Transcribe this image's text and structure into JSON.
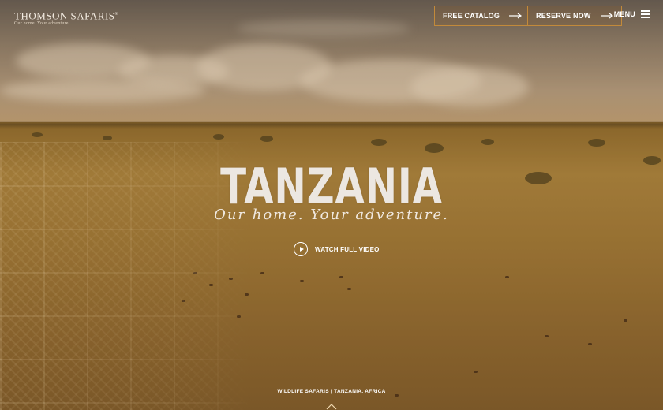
{
  "brand": {
    "name": "THOMSON SAFARIS",
    "registered": "®",
    "tagline": "Our home. Your adventure."
  },
  "header": {
    "catalog_label": "FREE CATALOG",
    "reserve_label": "RESERVE NOW",
    "menu_label": "MENU"
  },
  "hero": {
    "headline": "TANZANIA",
    "script_tagline": "Our home. Your adventure.",
    "video_label": "WATCH FULL VIDEO",
    "footer_label": "WILDLIFE SAFARIS | TANZANIA, AFRICA"
  },
  "icons": [
    "arrow-right-icon",
    "hamburger-icon",
    "play-icon",
    "chevron-up-icon"
  ],
  "colors": {
    "accent_border": "#c28a3b",
    "text": "#ffffff",
    "grass": "#a9843f"
  }
}
